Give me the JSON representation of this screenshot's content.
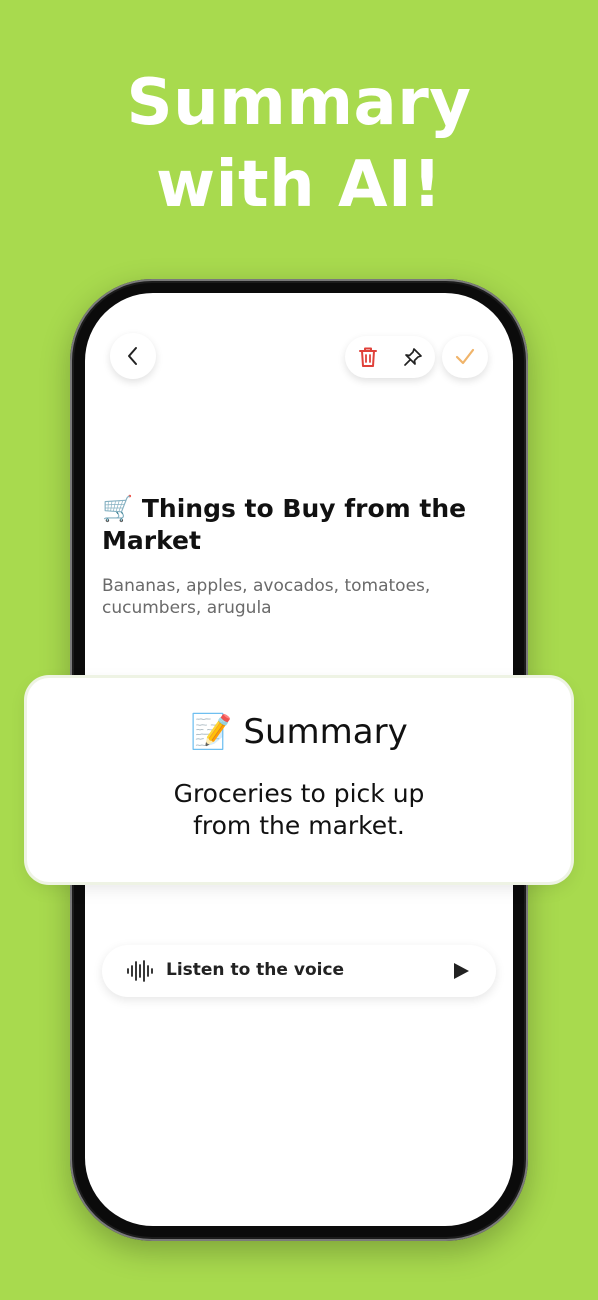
{
  "headline": {
    "line1": "Summary",
    "line2": "with AI!"
  },
  "toolbar": {
    "back_icon": "chevron-left-icon",
    "delete_icon": "trash-icon",
    "pin_icon": "pin-icon",
    "save_icon": "check-icon"
  },
  "note": {
    "title_emoji": "🛒",
    "title": "Things to Buy from the Market",
    "body": "Bananas, apples, avocados, tomatoes, cucumbers, arugula"
  },
  "summary": {
    "emoji": "📝",
    "heading": "Summary",
    "line1": "Groceries to pick up",
    "line2": "from the market."
  },
  "voice": {
    "label": "Listen to the voice"
  },
  "colors": {
    "background": "#a8da4e",
    "delete": "#e0413a",
    "check": "#f0b46a"
  }
}
